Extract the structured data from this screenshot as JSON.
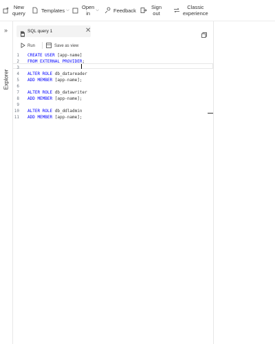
{
  "toolbar": {
    "new_query_line1": "New",
    "new_query_line2": "query",
    "templates": "Templates",
    "open_in_line1": "Open",
    "open_in_line2": "in",
    "feedback": "Feedback",
    "sign_out_line1": "Sign",
    "sign_out_line2": "out",
    "classic_line1": "Classic",
    "classic_line2": "experience"
  },
  "rail": {
    "expand_icon": "chevron-double-right-icon",
    "explorer_label": "Explorer"
  },
  "tab": {
    "title": "SQL query 1",
    "close_glyph": "✕"
  },
  "commands": {
    "run_label": "Run",
    "save_view_label": "Save as view"
  },
  "editor": {
    "lines": [
      {
        "n": "1",
        "kw": "CREATE USER",
        "rest": " [app-name]"
      },
      {
        "n": "2",
        "kw": "FROM EXTERNAL PROVIDER",
        "rest": ";"
      },
      {
        "n": "3",
        "kw": "",
        "rest": ""
      },
      {
        "n": "4",
        "kw": "ALTER ROLE",
        "rest": " db_datareader"
      },
      {
        "n": "5",
        "kw": "ADD MEMBER",
        "rest": " [app-name];"
      },
      {
        "n": "6",
        "kw": "",
        "rest": ""
      },
      {
        "n": "7",
        "kw": "ALTER ROLE",
        "rest": " db_datawriter"
      },
      {
        "n": "8",
        "kw": "ADD MEMBER",
        "rest": " [app-name];"
      },
      {
        "n": "9",
        "kw": "",
        "rest": ""
      },
      {
        "n": "10",
        "kw": "ALTER ROLE",
        "rest": " db_ddladmin"
      },
      {
        "n": "11",
        "kw": "ADD MEMBER",
        "rest": " [app-name];"
      }
    ]
  },
  "colors": {
    "keyword": "#0000ff",
    "line_number": "#6e7681",
    "tab_bg": "#f3f3f3"
  }
}
